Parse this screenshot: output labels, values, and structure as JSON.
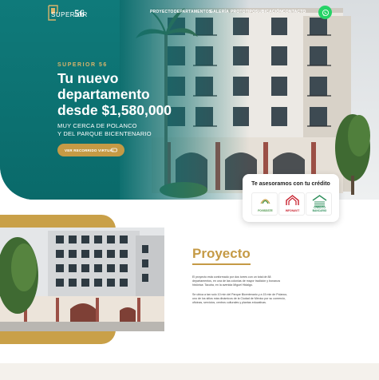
{
  "nav": {
    "logo_text": "SUPERIOR",
    "logo_number": "56",
    "links": [
      "PROYECTO",
      "DEPARTAMENTOS",
      "GALERÍA",
      "PROTOTIPOS",
      "UBICACIÓN",
      "CONTACTO"
    ],
    "whatsapp_icon": "whatsapp-icon"
  },
  "hero": {
    "kicker": "SUPERIOR 56",
    "title_line1": "Tu nuevo",
    "title_line2": "departamento",
    "title_line3": "desde $1,580,000",
    "subtitle_line1": "MUY CERCA DE POLANCO",
    "subtitle_line2": "Y DEL PARQUE BICENTENARIO",
    "button_label": "VER RECORRIDO VIRTUAL"
  },
  "credit": {
    "title": "Te asesoramos con tu crédito",
    "logos": [
      {
        "name": "FOVISSSTE",
        "color": "#3d8c3a"
      },
      {
        "name": "INFONAVIT",
        "color": "#c8202d"
      },
      {
        "name": "CRÉDITO BANCARIO",
        "color": "#2f8f5c"
      }
    ]
  },
  "proyecto": {
    "title": "Proyecto",
    "para1_line1": "El proyecto está conformado por dos torres con un total de 88",
    "para1_line2": "departamentos, en una de las colonias de mayor tradición y bonanza",
    "para1_line3": "histórica: Tacuba, en la avenida Miguel Hidalgo.",
    "para2_line1": "Se ubica a tan solo 10 min del Parque Bicentenario y a 15 min de Polanco,",
    "para2_line2": "uno de los sitios más dinámicos de la Ciudad de México por su comercio,",
    "para2_line3": "oficinas, servicios, centros culturales y plantas educativas."
  },
  "colors": {
    "teal": "#0e6f6f",
    "gold": "#c59a45",
    "whatsapp": "#25d366"
  }
}
